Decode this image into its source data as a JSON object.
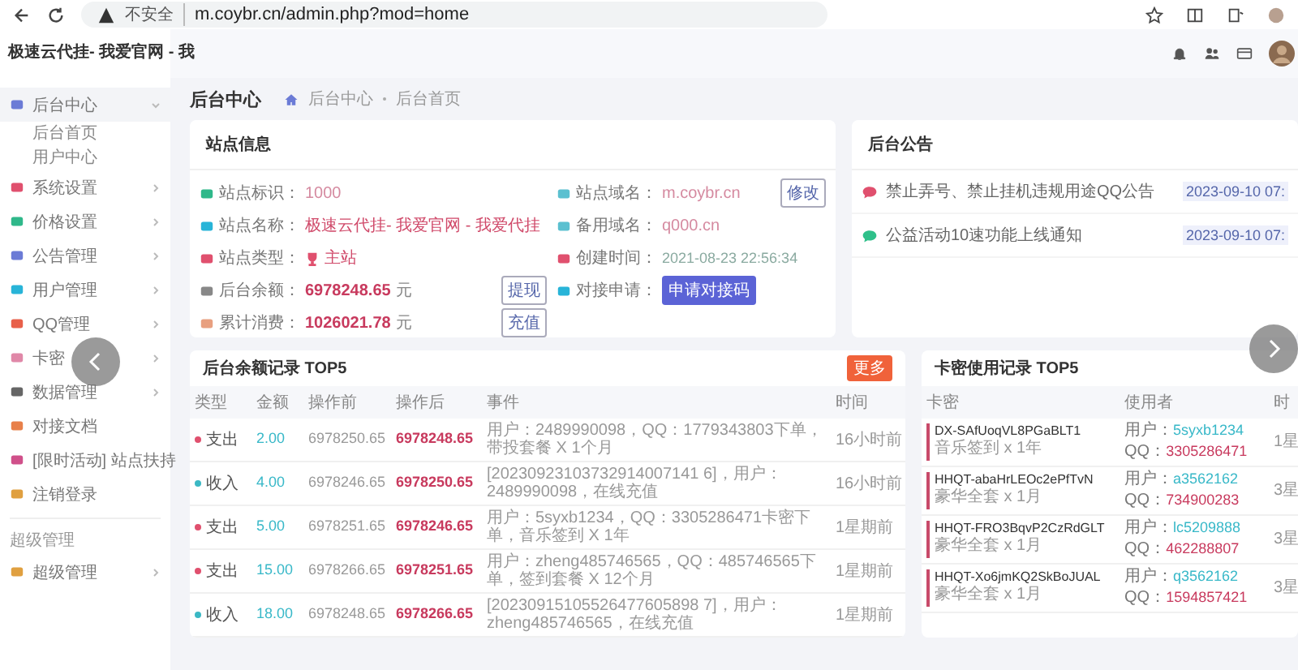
{
  "browser": {
    "warning": "不安全",
    "url": "m.coybr.cn/admin.php?mod=home"
  },
  "site_title": "极速云代挂- 我爱官网 - 我",
  "sidebar": {
    "items": [
      {
        "label": "后台中心",
        "kind": "group",
        "selected": true,
        "expanded": true,
        "children": [
          {
            "label": "后台首页"
          },
          {
            "label": "用户中心"
          }
        ]
      },
      {
        "label": "系统设置",
        "kind": "group",
        "selected": false,
        "expanded": false
      },
      {
        "label": "价格设置",
        "kind": "group",
        "selected": false,
        "expanded": false
      },
      {
        "label": "公告管理",
        "kind": "group",
        "selected": false,
        "expanded": false
      },
      {
        "label": "用户管理",
        "kind": "group",
        "selected": false,
        "expanded": false
      },
      {
        "label": "QQ管理",
        "kind": "group",
        "selected": false,
        "expanded": false
      },
      {
        "label": "卡密",
        "kind": "group",
        "selected": false,
        "expanded": false
      },
      {
        "label": "数据管理",
        "kind": "group",
        "selected": false,
        "expanded": false
      },
      {
        "label": "对接文档",
        "kind": "link",
        "selected": false
      },
      {
        "label": "[限时活动] 站点扶持",
        "kind": "link",
        "selected": false
      },
      {
        "label": "注销登录",
        "kind": "link",
        "selected": false
      }
    ],
    "section": "超级管理",
    "section_items": [
      {
        "label": "超级管理",
        "kind": "group",
        "selected": false,
        "expanded": false
      }
    ]
  },
  "page": {
    "title": "后台中心",
    "breadcrumb": [
      "后台中心",
      "后台首页"
    ]
  },
  "site_info": {
    "title": "站点信息",
    "left": [
      {
        "label": "站点标识：",
        "value": "1000",
        "kind": "text"
      },
      {
        "label": "站点名称：",
        "value": "极速云代挂- 我爱官网 - 我爱代挂",
        "kind": "name"
      },
      {
        "label": "站点类型：",
        "value": "主站",
        "kind": "tag"
      },
      {
        "label": "后台余额：",
        "value": "6978248.65",
        "unit": "元",
        "kind": "money",
        "button": "提现"
      },
      {
        "label": "累计消费：",
        "value": "1026021.78",
        "unit": "元",
        "kind": "money",
        "button": "充值"
      }
    ],
    "right": [
      {
        "label": "站点域名：",
        "value": "m.coybr.cn",
        "kind": "text",
        "button": "修改"
      },
      {
        "label": "备用域名：",
        "value": "q000.cn",
        "kind": "text"
      },
      {
        "label": "创建时间：",
        "value": "2021-08-23 22:56:34",
        "kind": "date"
      },
      {
        "label": "对接申请：",
        "value": "申请对接码",
        "kind": "action"
      }
    ]
  },
  "announcements": {
    "title": "后台公告",
    "items": [
      {
        "text": "禁止弄号、禁止挂机违规用途QQ公告",
        "date": "2023-09-10 07:",
        "color": "#e0506e"
      },
      {
        "text": "公益活动10速功能上线通知",
        "date": "2023-09-10 07:",
        "color": "#2fc08a"
      }
    ]
  },
  "balance_log": {
    "title": "后台余额记录 TOP5",
    "more": "更多",
    "columns": [
      "类型",
      "金额",
      "操作前",
      "操作后",
      "事件",
      "时间"
    ],
    "rows": [
      {
        "type": "支出",
        "color": "#e0506e",
        "amount": "2.00",
        "before": "6978250.65",
        "after": "6978248.65",
        "event": "用户：2489990098，QQ：1779343803下单，带投套餐 X 1个月",
        "time": "16小时前"
      },
      {
        "type": "收入",
        "color": "#3bb8c4",
        "amount": "4.00",
        "before": "6978246.65",
        "after": "6978250.65",
        "event": "[20230923103732914007141 6]，用户：2489990098，在线充值",
        "time": "16小时前"
      },
      {
        "type": "支出",
        "color": "#e0506e",
        "amount": "5.00",
        "before": "6978251.65",
        "after": "6978246.65",
        "event": "用户：5syxb1234，QQ：3305286471卡密下单，音乐签到 X 1年",
        "time": "1星期前"
      },
      {
        "type": "支出",
        "color": "#e0506e",
        "amount": "15.00",
        "before": "6978266.65",
        "after": "6978251.65",
        "event": "用户：zheng485746565，QQ：485746565下单，签到套餐 X 12个月",
        "time": "1星期前"
      },
      {
        "type": "收入",
        "color": "#3bb8c4",
        "amount": "18.00",
        "before": "6978248.65",
        "after": "6978266.65",
        "event": "[20230915105526477605898 7]，用户：zheng485746565，在线充值",
        "time": "1星期前"
      }
    ]
  },
  "card_log": {
    "title": "卡密使用记录 TOP5",
    "columns": [
      "卡密",
      "使用者",
      "时"
    ],
    "rows": [
      {
        "code": "DX-SAfUoqVL8PGaBLT1",
        "desc": "音乐签到 x 1年",
        "user_label": "用户：",
        "user": "5syxb1234",
        "qq_label": "QQ：",
        "qq": "3305286471",
        "time": "1星"
      },
      {
        "code": "HHQT-abaHrLEOc2ePfTvN",
        "desc": "豪华全套 x 1月",
        "user_label": "用户：",
        "user": "a3562162",
        "qq_label": "QQ：",
        "qq": "734900283",
        "time": "3星"
      },
      {
        "code": "HHQT-FRO3BqvP2CzRdGLT",
        "desc": "豪华全套 x 1月",
        "user_label": "用户：",
        "user": "lc5209888",
        "qq_label": "QQ：",
        "qq": "462288807",
        "time": "3星"
      },
      {
        "code": "HHQT-Xo6jmKQ2SkBoJUAL",
        "desc": "豪华全套 x 1月",
        "user_label": "用户：",
        "user": "q3562162",
        "qq_label": "QQ：",
        "qq": "1594857421",
        "time": "3星"
      }
    ]
  }
}
